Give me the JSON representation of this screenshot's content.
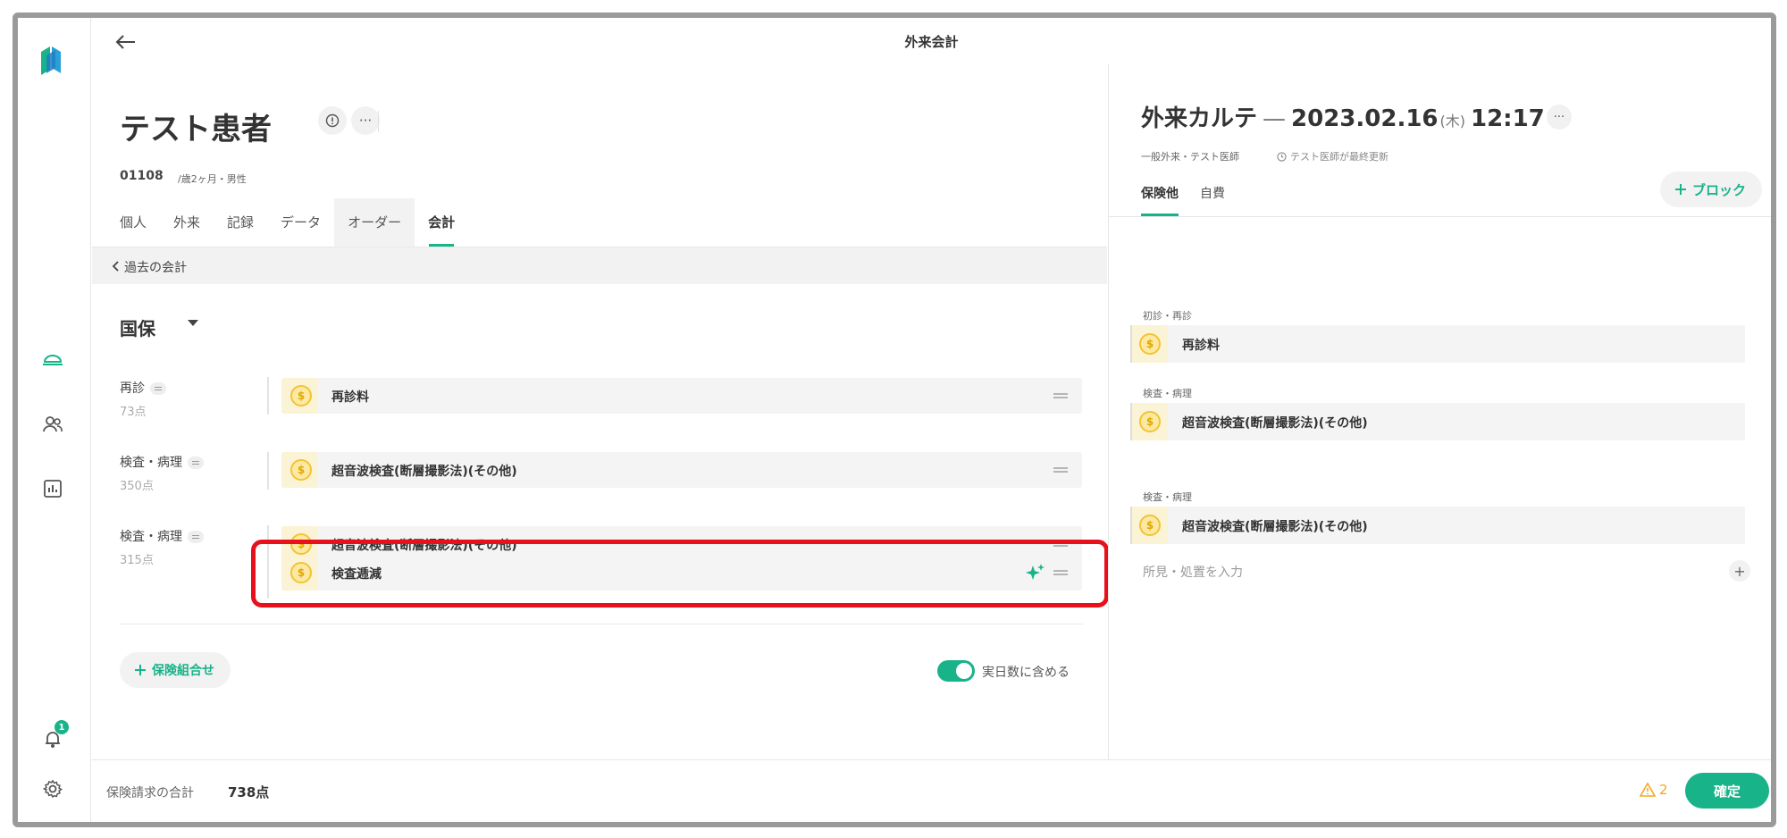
{
  "header": {
    "title": "外来会計"
  },
  "patient": {
    "name": "テスト患者",
    "id": "01108",
    "info": "/歳2ヶ月・男性",
    "more_label": "···"
  },
  "tabs": [
    "個人",
    "外来",
    "記録",
    "データ",
    "オーダー",
    "会計"
  ],
  "active_tab": "会計",
  "history_link": "過去の会計",
  "insurance": {
    "name": "国保"
  },
  "groups": [
    {
      "label": "再診",
      "points": "73点",
      "items": [
        "再診料"
      ]
    },
    {
      "label": "検査・病理",
      "points": "350点",
      "items": [
        "超音波検査(断層撮影法)(その他)"
      ]
    },
    {
      "label": "検査・病理",
      "points": "315点",
      "items": [
        "超音波検査(断層撮影法)(その他)",
        "検査逓減"
      ]
    }
  ],
  "add_combo_label": "保険組合せ",
  "toggle": {
    "label": "実日数に含める",
    "on": true
  },
  "karte": {
    "type": "外来カルテ",
    "date": "2023.02.16",
    "dow": "(木)",
    "time": "12:17",
    "subtitle": "一般外来・テスト医師",
    "updated": "テスト医師が最終更新",
    "tabs": [
      "保険他",
      "自費"
    ],
    "active_tab": "保険他",
    "block_button": "ブロック",
    "sections": [
      {
        "title": "初診・再診",
        "item": "再診料"
      },
      {
        "title": "検査・病理",
        "item": "超音波検査(断層撮影法)(その他)"
      },
      {
        "title": "検査・病理",
        "item": "超音波検査(断層撮影法)(その他)"
      }
    ],
    "input_placeholder": "所見・処置を入力"
  },
  "footer": {
    "total_label": "保険請求の合計",
    "total_value": "738点",
    "warning_count": "2",
    "confirm_label": "確定"
  },
  "notification_count": "1",
  "colors": {
    "accent": "#19b389",
    "highlight": "#e8101a",
    "coin": "#f3c332"
  },
  "icons": [
    "logo-icon",
    "back-arrow-icon",
    "bed-icon",
    "people-icon",
    "chart-icon",
    "bell-icon",
    "gear-icon",
    "coin-icon",
    "sparkle-icon",
    "drag-handle-icon",
    "clock-icon",
    "warning-icon",
    "plus-icon"
  ]
}
